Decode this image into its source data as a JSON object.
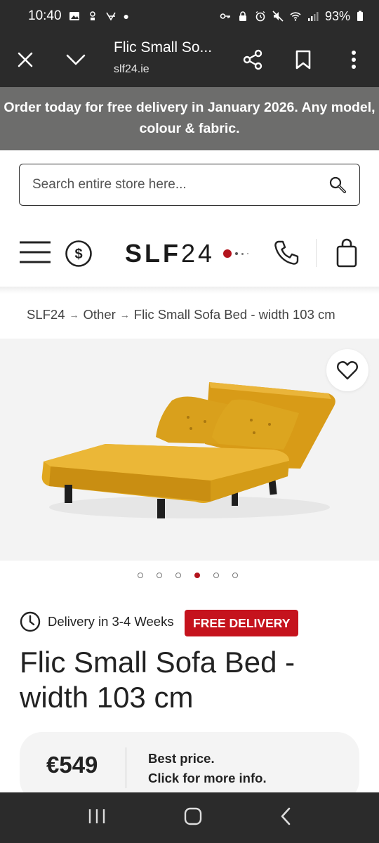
{
  "status_bar": {
    "time": "10:40",
    "battery": "93%"
  },
  "browser": {
    "title": "Flic Small So...",
    "url": "slf24.ie"
  },
  "promo": {
    "text": "Order today for free delivery in January 2026. Any model, colour & fabric."
  },
  "search": {
    "placeholder": "Search entire store here..."
  },
  "header": {
    "logo_text": "SLF",
    "logo_num": "24"
  },
  "breadcrumb": {
    "items": [
      "SLF24",
      "Other",
      "Flic Small Sofa Bed - width 103 cm"
    ]
  },
  "gallery": {
    "slide_count": 6,
    "active_slide": 4
  },
  "product": {
    "delivery": "Delivery in 3-4 Weeks",
    "badge": "FREE DELIVERY",
    "title": "Flic Small Sofa Bed - width 103 cm",
    "price": "€549",
    "price_info_line1": "Best price.",
    "price_info_line2": "Click for more info."
  },
  "colors": {
    "accent": "#c5131d",
    "bars": "#2b2b2b",
    "promo": "#6d6d6c",
    "sofa": "#e0a71f"
  }
}
